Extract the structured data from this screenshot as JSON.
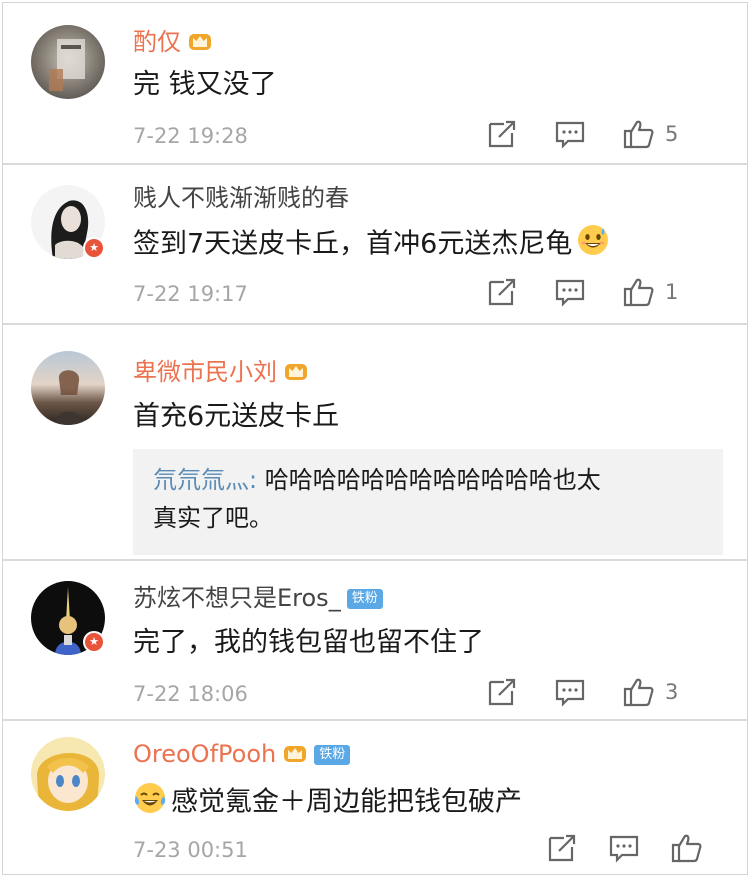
{
  "comments": [
    {
      "user": "酌仅",
      "text": "完 钱又没了",
      "time": "7-22 19:28",
      "likes": "5"
    },
    {
      "user": "贱人不贱渐渐贱的春",
      "text": "签到7天送皮卡丘，首冲6元送杰尼龟",
      "time": "7-22 19:17",
      "likes": "1"
    },
    {
      "user": "卑微市民小刘",
      "text": "首充6元送皮卡丘",
      "quote_user": "氘氘氚灬:",
      "quote_text_line1": " 哈哈哈哈哈哈哈哈哈哈哈哈也太",
      "quote_text_line2": "真实了吧。"
    },
    {
      "user": "苏炫不想只是Eros_",
      "fan_badge": "铁粉",
      "text": "完了，我的钱包留也留不住了",
      "time": "7-22 18:06",
      "likes": "3"
    },
    {
      "user": "OreoOfPooh",
      "fan_badge": "铁粉",
      "text": "感觉氪金＋周边能把钱包破产",
      "time": "7-23 00:51",
      "likes": ""
    }
  ],
  "colors": {
    "vip_name": "#eb7350",
    "quote_name": "#5b8bb5",
    "fan_badge": "#5aa8e6",
    "crown": "#f0a52b"
  }
}
